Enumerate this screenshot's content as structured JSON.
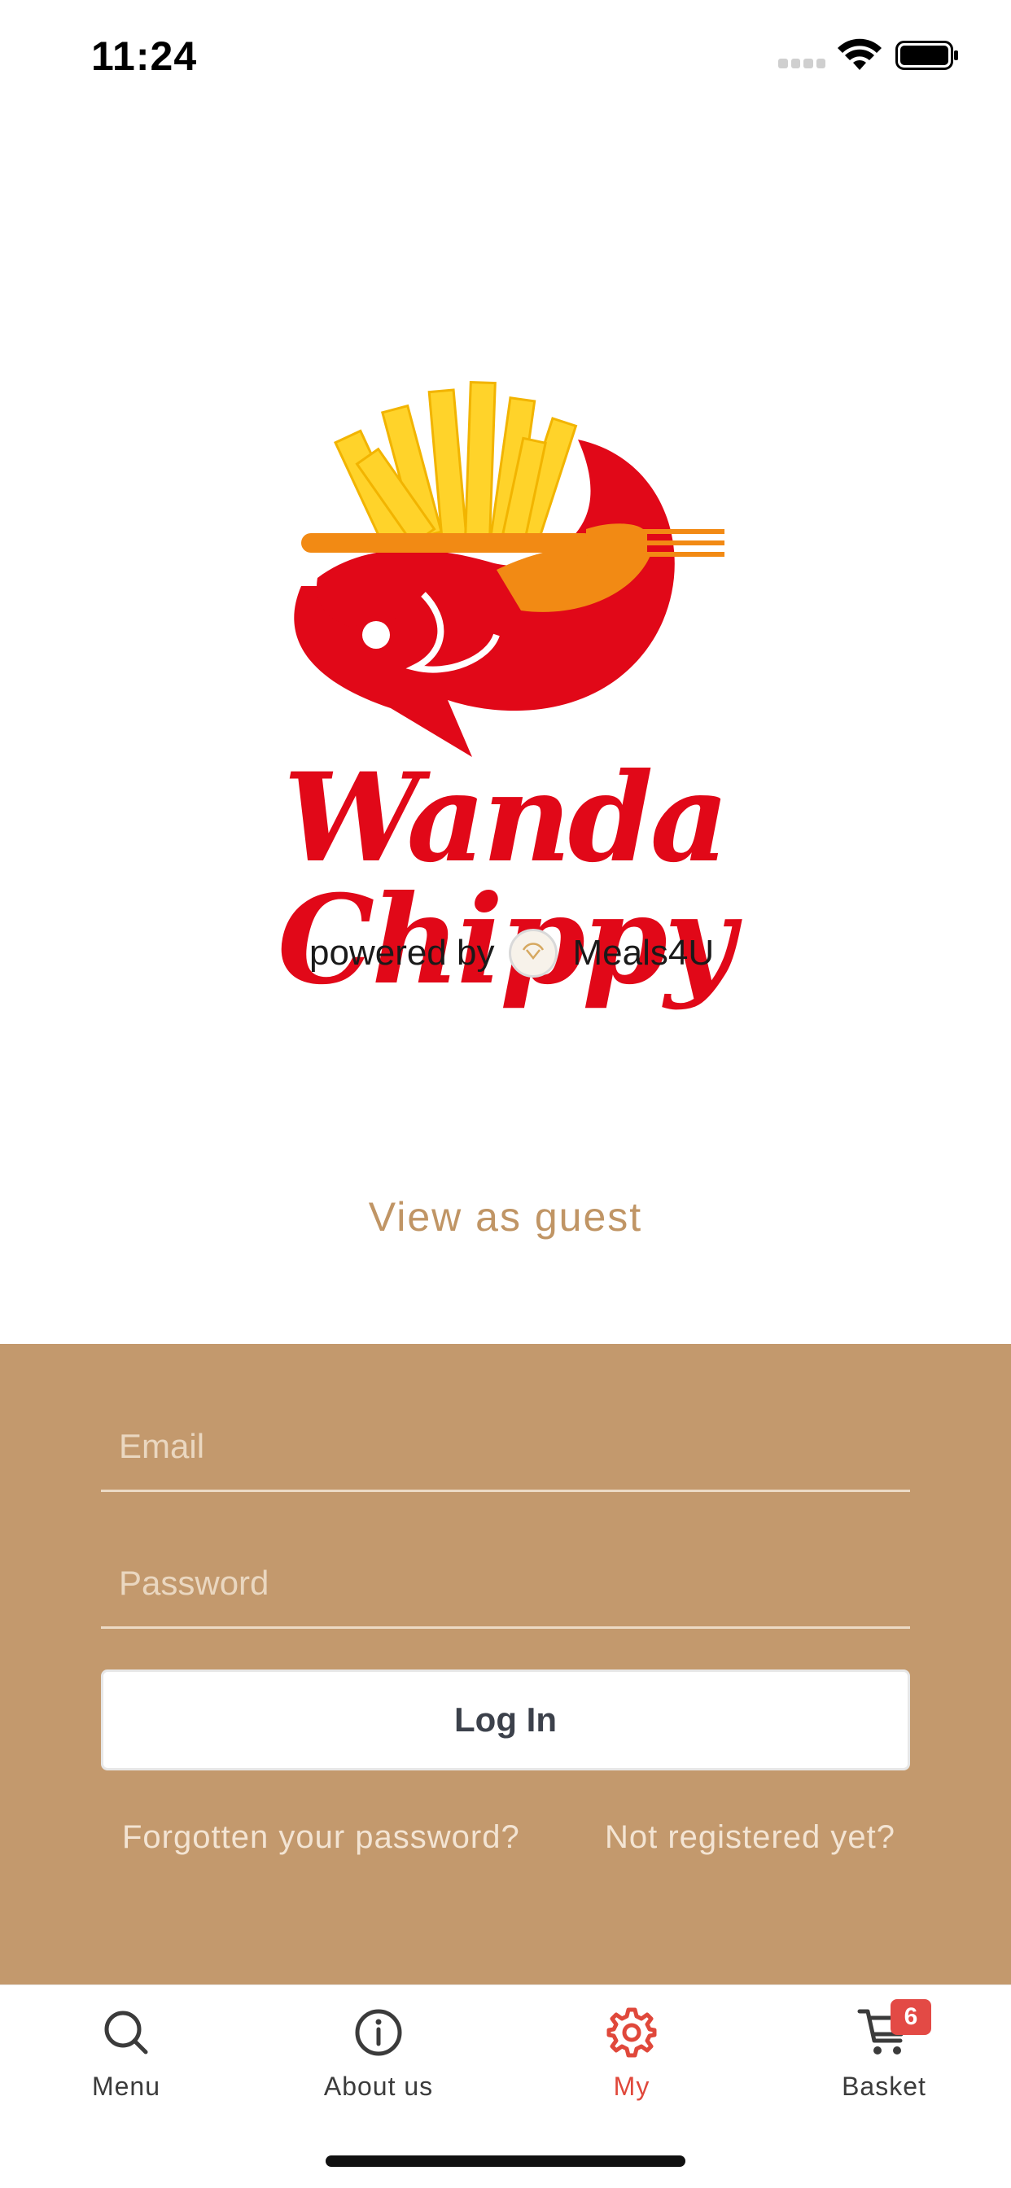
{
  "status_bar": {
    "time": "11:24"
  },
  "brand": {
    "name": "Wanda Chippy",
    "powered_by": "powered by",
    "partner": "Meals4U"
  },
  "guest": {
    "label": "View as guest"
  },
  "login": {
    "email_placeholder": "Email",
    "password_placeholder": "Password",
    "submit_label": "Log In",
    "forgot_label": "Forgotten your password?",
    "register_label": "Not registered yet?"
  },
  "tabs": [
    {
      "label": "Menu",
      "icon": "search-icon"
    },
    {
      "label": "About us",
      "icon": "info-icon"
    },
    {
      "label": "My",
      "icon": "gear-icon",
      "active": true
    },
    {
      "label": "Basket",
      "icon": "cart-icon",
      "badge": "6"
    }
  ],
  "colors": {
    "accent": "#c3996d",
    "brand_red": "#e10818",
    "active_tab": "#e0483b",
    "badge": "#e34a45"
  }
}
